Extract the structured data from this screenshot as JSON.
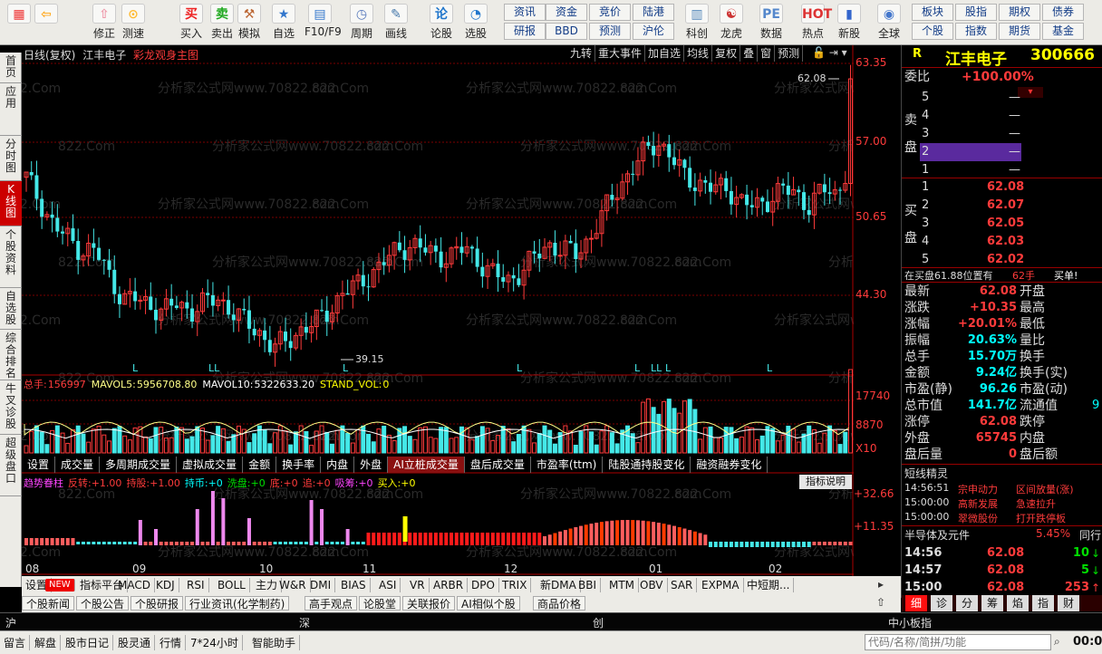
{
  "toolbar": {
    "buttons": [
      {
        "label": "",
        "name": "menu-grid-icon"
      },
      {
        "label": "",
        "name": "back-arrow-icon"
      },
      {
        "label": "修正",
        "name": "adjust-icon"
      },
      {
        "label": "测速",
        "name": "speedtest-icon"
      },
      {
        "label": "买入",
        "name": "buy-icon"
      },
      {
        "label": "卖出",
        "name": "sell-icon"
      },
      {
        "label": "模拟",
        "name": "simulate-icon"
      },
      {
        "label": "自选",
        "name": "watchlist-icon"
      },
      {
        "label": "F10/F9",
        "name": "f10-icon"
      },
      {
        "label": "周期",
        "name": "period-icon"
      },
      {
        "label": "画线",
        "name": "draw-line-icon"
      },
      {
        "label": "论股",
        "name": "discuss-icon"
      },
      {
        "label": "选股",
        "name": "stock-picker-icon"
      },
      {
        "label": "科创",
        "name": "star-market-icon"
      },
      {
        "label": "龙虎",
        "name": "dragon-tiger-icon"
      },
      {
        "label": "数据",
        "name": "data-icon"
      },
      {
        "label": "热点",
        "name": "hot-icon"
      },
      {
        "label": "新股",
        "name": "ipo-icon"
      },
      {
        "label": "全球",
        "name": "global-icon"
      }
    ],
    "small": [
      "资讯",
      "资金",
      "竞价",
      "陆港",
      "研报",
      "BBD",
      "预测",
      "沪伦",
      "板块",
      "股指",
      "期权",
      "债券",
      "个股",
      "指数",
      "期货",
      "基金"
    ]
  },
  "sidenav": [
    "首页",
    "应用",
    "分时图",
    "K线图",
    "个股资料",
    "自选股",
    "综合排名",
    "牛叉诊股",
    "超级盘口"
  ],
  "chart": {
    "header_left": "日线(复权)",
    "stock": "江丰电子",
    "overlay": "彩龙观身主图",
    "header_tools": [
      "九转",
      "重大事件",
      "加自选",
      "均线",
      "复权",
      "叠",
      "窗",
      "预测"
    ],
    "price_axis": [
      "63.35",
      "57.00",
      "50.65",
      "44.30"
    ],
    "high_label": "62.08",
    "low_label": "39.15",
    "vol_header": {
      "total_label": "总手:",
      "total": "156997",
      "mavol5_label": "MAVOL5:",
      "mavol5": "5956708.80",
      "mavol10_label": "MAVOL10:",
      "mavol10": "5322633.20",
      "stand_label": "STAND_VOL:",
      "stand": "0"
    },
    "vol_axis": [
      "17740",
      "8870",
      "X10"
    ],
    "vol_tabs": [
      "设置",
      "成交量",
      "多周期成交量",
      "虚拟成交量",
      "金额",
      "换手率",
      "内盘",
      "外盘",
      "AI立桩成交量",
      "盘后成交量",
      "市盈率(ttm)",
      "陆股通持股变化",
      "融资融券变化"
    ],
    "ind_header": [
      {
        "t": "趋势眷柱",
        "c": "#ff44ff"
      },
      {
        "t": "反转:",
        "c": "#ff3b3b"
      },
      {
        "t": "+1.00",
        "c": "#ff3b3b"
      },
      {
        "t": "持股:",
        "c": "#ff3b3b"
      },
      {
        "t": "+1.00",
        "c": "#ff3b3b"
      },
      {
        "t": "持币:",
        "c": "#00ffff"
      },
      {
        "t": "+0",
        "c": "#00ffff"
      },
      {
        "t": "洗盘:",
        "c": "#00e000"
      },
      {
        "t": "+0",
        "c": "#00e000"
      },
      {
        "t": "底:",
        "c": "#ff3b3b"
      },
      {
        "t": "+0",
        "c": "#ff3b3b"
      },
      {
        "t": "追:",
        "c": "#ff3b3b"
      },
      {
        "t": "+0",
        "c": "#ff3b3b"
      },
      {
        "t": "吸筹:",
        "c": "#ff44ff"
      },
      {
        "t": "+0",
        "c": "#ff44ff"
      },
      {
        "t": "买入:",
        "c": "#ffff00"
      },
      {
        "t": "+0",
        "c": "#ffff00"
      }
    ],
    "ind_btn": "指标说明",
    "ind_axis": [
      "+32.66",
      "+11.35"
    ],
    "months": [
      "08",
      "09",
      "10",
      "11",
      "12",
      "01",
      "02"
    ],
    "l_marks": [
      "L",
      "LL",
      "L",
      "L",
      "L",
      "LL",
      "L",
      "L"
    ]
  },
  "bottom_tabs": [
    "设置",
    "NEW",
    "指标平台",
    "MACD",
    "KDJ",
    "RSI",
    "BOLL",
    "主力",
    "W&R",
    "DMI",
    "BIAS",
    "ASI",
    "VR",
    "ARBR",
    "DPO",
    "TRIX",
    "新DMA",
    "BBI",
    "MTM",
    "OBV",
    "SAR",
    "EXPMA",
    "中短期..."
  ],
  "news_tabs": [
    "个股新闻",
    "个股公告",
    "个股研报",
    "行业资讯(化学制药)",
    "高手观点",
    "论股堂",
    "关联报价",
    "AI相似个股",
    "商品价格"
  ],
  "index_bar": {
    "sh": "沪",
    "sz": "深",
    "cy": "创",
    "zx": "中小板指"
  },
  "status": {
    "items": [
      "留言",
      "解盘",
      "股市日记",
      "股灵通",
      "行情",
      "7*24小时",
      "智能助手"
    ],
    "search_placeholder": "代码/名称/简拼/功能",
    "time": "00:0"
  },
  "right": {
    "R": "R",
    "name": "江丰电子",
    "code": "300666",
    "wb_label": "委比",
    "wb": "+100.00%",
    "sell_label": "卖盘",
    "buy_label": "买盘",
    "sells": [
      {
        "n": "5",
        "p": "—",
        "v": ""
      },
      {
        "n": "4",
        "p": "—",
        "v": ""
      },
      {
        "n": "3",
        "p": "—",
        "v": ""
      },
      {
        "n": "2",
        "p": "—",
        "v": ""
      },
      {
        "n": "1",
        "p": "—",
        "v": ""
      }
    ],
    "buys": [
      {
        "n": "1",
        "p": "62.08"
      },
      {
        "n": "2",
        "p": "62.07"
      },
      {
        "n": "3",
        "p": "62.05"
      },
      {
        "n": "4",
        "p": "62.03"
      },
      {
        "n": "5",
        "p": "62.02"
      }
    ],
    "bid_note": "在买盘61.88位置有",
    "bid_note_vol": "62手",
    "bid_note_act": "买单!",
    "quote": [
      [
        "最新",
        "62.08",
        "开盘",
        ""
      ],
      [
        "涨跌",
        "+10.35",
        "最高",
        ""
      ],
      [
        "涨幅",
        "+20.01%",
        "最低",
        ""
      ],
      [
        "振幅",
        "20.63%",
        "量比",
        ""
      ],
      [
        "总手",
        "15.70万",
        "换手",
        ""
      ],
      [
        "金额",
        "9.24亿",
        "换手(实)",
        ""
      ],
      [
        "市盈(静)",
        "96.26",
        "市盈(动)",
        ""
      ],
      [
        "总市值",
        "141.7亿",
        "流通值",
        "9"
      ],
      [
        "涨停",
        "62.08",
        "跌停",
        ""
      ],
      [
        "外盘",
        "65745",
        "内盘",
        ""
      ],
      [
        "盘后量",
        "0",
        "盘后额",
        ""
      ]
    ],
    "elves_title": "短线精灵",
    "elves": [
      [
        "14:56:51",
        "宗申动力",
        "区间放量(涨)"
      ],
      [
        "15:00:00",
        "高新发展",
        "急速拉升"
      ],
      [
        "15:00:00",
        "翠微股份",
        "打开跌停板"
      ]
    ],
    "sector": "半导体及元件",
    "sector_pct": "5.45%",
    "sector_tag": "同行",
    "ticks": [
      [
        "14:56",
        "62.08",
        "10"
      ],
      [
        "14:57",
        "62.08",
        "5"
      ],
      [
        "15:00",
        "62.08",
        "253"
      ]
    ],
    "tabs": [
      "细",
      "诊",
      "分",
      "筹",
      "焰",
      "指",
      "财"
    ]
  }
}
